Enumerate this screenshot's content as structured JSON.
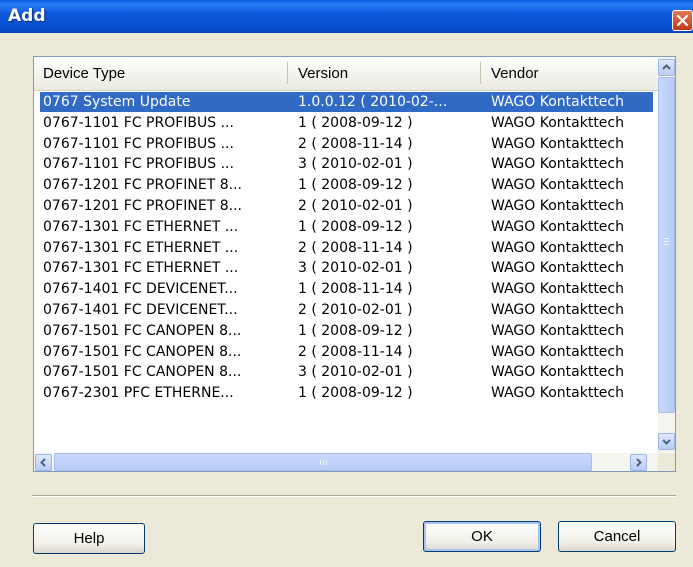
{
  "window": {
    "title": "Add"
  },
  "columns": {
    "device_type": "Device Type",
    "version": "Version",
    "vendor": "Vendor"
  },
  "rows": [
    {
      "device": "0767 System Update",
      "version": "1.0.0.12 ( 2010-02-...",
      "vendor": "WAGO Kontakttech",
      "selected": true
    },
    {
      "device": "0767-1101 FC PROFIBUS ...",
      "version": "1 ( 2008-09-12 )",
      "vendor": "WAGO Kontakttech"
    },
    {
      "device": "0767-1101 FC PROFIBUS ...",
      "version": "2 ( 2008-11-14 )",
      "vendor": "WAGO Kontakttech"
    },
    {
      "device": "0767-1101 FC PROFIBUS ...",
      "version": "3 ( 2010-02-01 )",
      "vendor": "WAGO Kontakttech"
    },
    {
      "device": "0767-1201 FC PROFINET 8...",
      "version": "1 ( 2008-09-12 )",
      "vendor": "WAGO Kontakttech"
    },
    {
      "device": "0767-1201 FC PROFINET 8...",
      "version": "2 ( 2010-02-01 )",
      "vendor": "WAGO Kontakttech"
    },
    {
      "device": "0767-1301 FC ETHERNET ...",
      "version": "1 ( 2008-09-12 )",
      "vendor": "WAGO Kontakttech"
    },
    {
      "device": "0767-1301 FC ETHERNET ...",
      "version": "2 ( 2008-11-14 )",
      "vendor": "WAGO Kontakttech"
    },
    {
      "device": "0767-1301 FC ETHERNET ...",
      "version": "3 ( 2010-02-01 )",
      "vendor": "WAGO Kontakttech"
    },
    {
      "device": "0767-1401 FC DEVICENET...",
      "version": "1 ( 2008-11-14 )",
      "vendor": "WAGO Kontakttech"
    },
    {
      "device": "0767-1401 FC DEVICENET...",
      "version": "2 ( 2010-02-01 )",
      "vendor": "WAGO Kontakttech"
    },
    {
      "device": "0767-1501 FC CANOPEN 8...",
      "version": "1 ( 2008-09-12 )",
      "vendor": "WAGO Kontakttech"
    },
    {
      "device": "0767-1501 FC CANOPEN 8...",
      "version": "2 ( 2008-11-14 )",
      "vendor": "WAGO Kontakttech"
    },
    {
      "device": "0767-1501 FC CANOPEN 8...",
      "version": "3 ( 2010-02-01 )",
      "vendor": "WAGO Kontakttech"
    },
    {
      "device": "0767-2301 PFC ETHERNE...",
      "version": "1 ( 2008-09-12 )",
      "vendor": "WAGO Kontakttech"
    }
  ],
  "buttons": {
    "help": "Help",
    "ok": "OK",
    "cancel": "Cancel"
  },
  "icons": {
    "close": "close-icon",
    "scroll_up": "chevron-up-icon",
    "scroll_down": "chevron-down-icon",
    "scroll_left": "chevron-left-icon",
    "scroll_right": "chevron-right-icon"
  },
  "colors": {
    "title_bar": "#0a5fe0",
    "selection": "#316ac5",
    "close_button": "#d5502c"
  }
}
